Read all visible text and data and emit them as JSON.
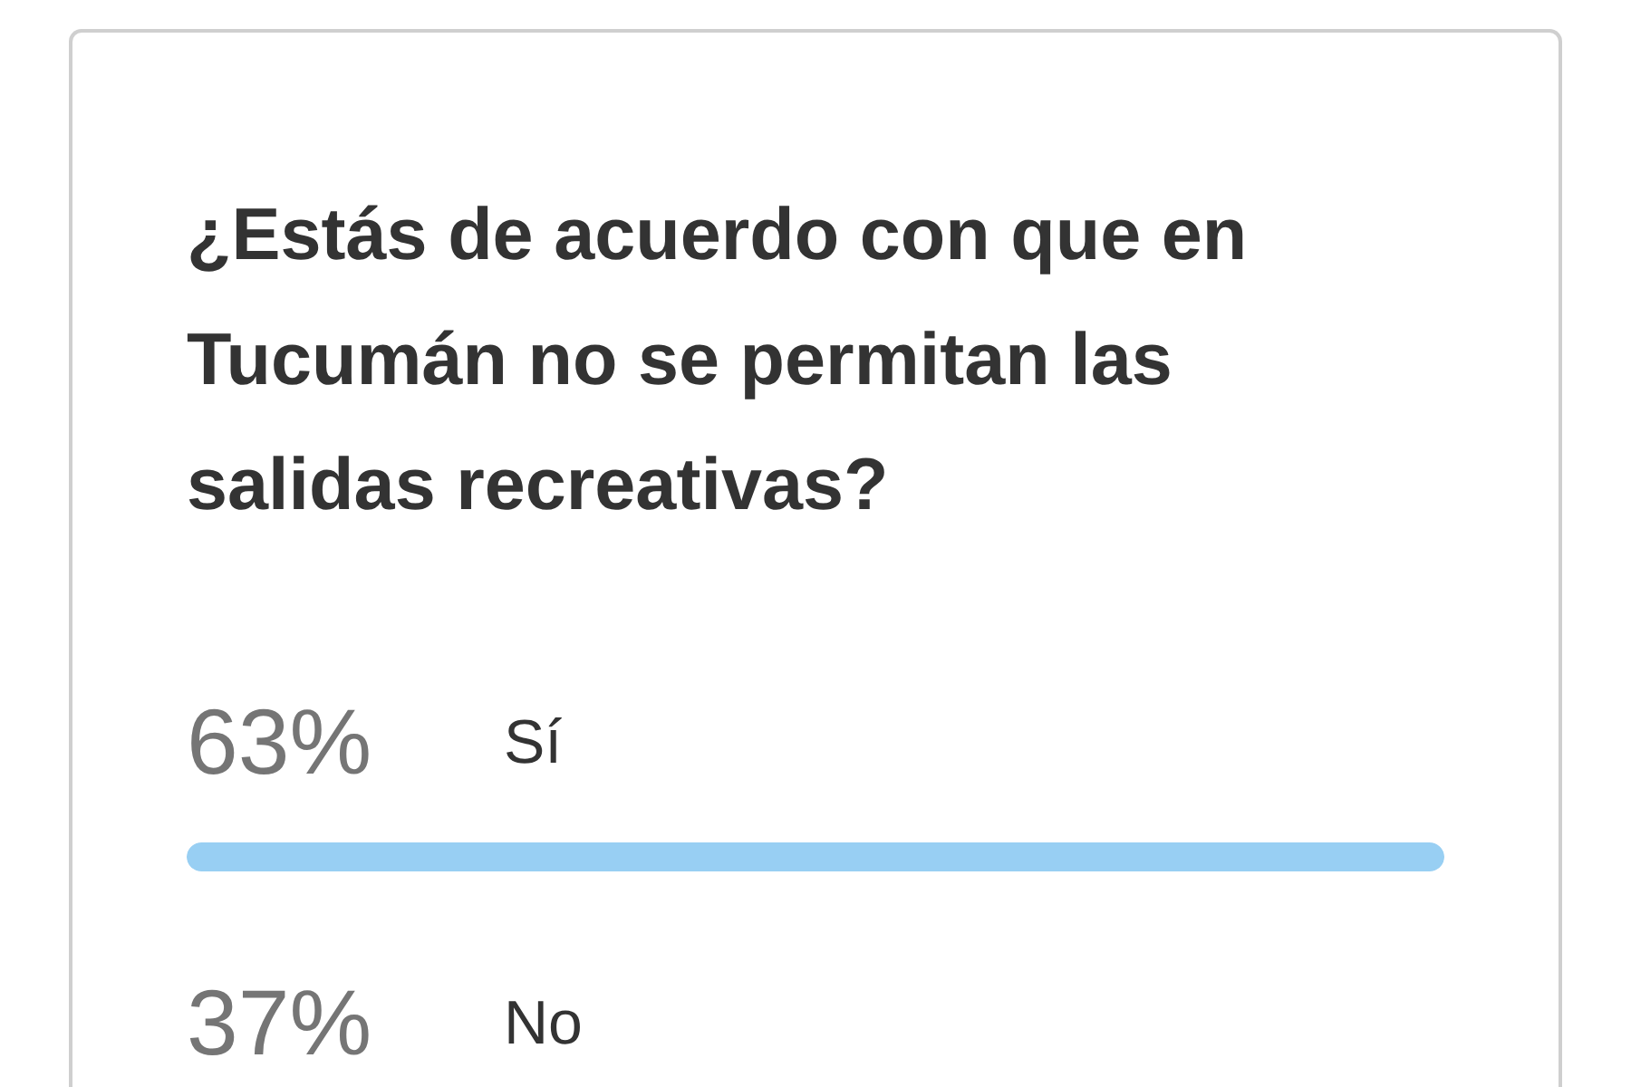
{
  "poll": {
    "question": "¿Estás de acuerdo con que en Tucumán no se permitan las salidas recreativas?",
    "options": [
      {
        "percent": "63%",
        "label": "Sí",
        "level": 1
      },
      {
        "percent": "37%",
        "label": "No"
      }
    ]
  }
}
